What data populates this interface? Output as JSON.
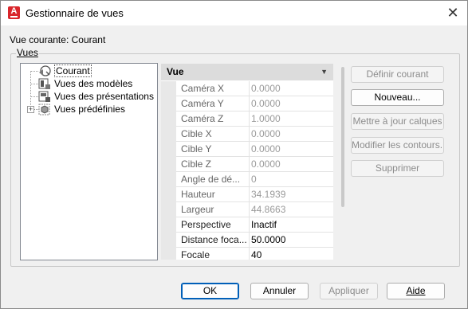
{
  "window": {
    "title": "Gestionnaire de vues",
    "app_icon_letter": "A",
    "close_glyph": "✕"
  },
  "current_view_label": "Vue courante: Courant",
  "group": {
    "legend": "Vues"
  },
  "tree": {
    "items": [
      {
        "label": "Courant",
        "icon": "camera-icon",
        "selected": true
      },
      {
        "label": "Vues des modèles",
        "icon": "model-views-icon"
      },
      {
        "label": "Vues des présentations",
        "icon": "layout-views-icon"
      },
      {
        "label": "Vues prédéfinies",
        "icon": "preset-views-icon",
        "expander": "+"
      }
    ]
  },
  "properties": {
    "header": "Vue",
    "rows": [
      {
        "name": "Caméra X",
        "value": "0.0000",
        "editable": false
      },
      {
        "name": "Caméra Y",
        "value": "0.0000",
        "editable": false
      },
      {
        "name": "Caméra Z",
        "value": "1.0000",
        "editable": false
      },
      {
        "name": "Cible X",
        "value": "0.0000",
        "editable": false
      },
      {
        "name": "Cible Y",
        "value": "0.0000",
        "editable": false
      },
      {
        "name": "Cible Z",
        "value": "0.0000",
        "editable": false
      },
      {
        "name": "Angle de dé...",
        "value": "0",
        "editable": false
      },
      {
        "name": "Hauteur",
        "value": "34.1939",
        "editable": false
      },
      {
        "name": "Largeur",
        "value": "44.8663",
        "editable": false
      },
      {
        "name": "Perspective",
        "value": "Inactif",
        "editable": true
      },
      {
        "name": "Distance foca...",
        "value": "50.0000",
        "editable": true
      },
      {
        "name": "Focale",
        "value": "40",
        "editable": true
      }
    ]
  },
  "side_buttons": [
    {
      "label": "Définir courant",
      "enabled": false
    },
    {
      "label": "Nouveau...",
      "enabled": true
    },
    {
      "label": "Mettre à jour calques",
      "enabled": false
    },
    {
      "label": "Modifier les contours...",
      "enabled": false
    },
    {
      "label": "Supprimer",
      "enabled": false
    }
  ],
  "bottom_buttons": {
    "ok": "OK",
    "cancel": "Annuler",
    "apply": "Appliquer",
    "help": "Aide"
  },
  "colors": {
    "accent": "#005fb8",
    "app_icon": "#d9262b"
  }
}
